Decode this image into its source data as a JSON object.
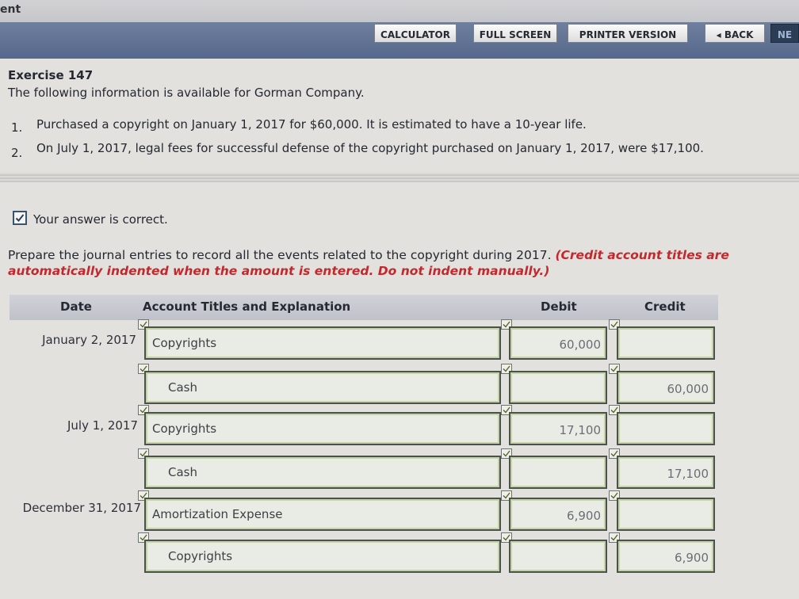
{
  "header": {
    "section_word": "ent"
  },
  "toolbar": {
    "calculator": "CALCULATOR",
    "full_screen": "FULL SCREEN",
    "printer_version": "PRINTER VERSION",
    "back": "◂ BACK",
    "next": "NE"
  },
  "exercise": {
    "title": "Exercise 147",
    "intro": "The following information is available for Gorman Company.",
    "items": [
      {
        "num": "1.",
        "text": "Purchased a copyright on January 1, 2017 for $60,000. It is estimated to have a 10-year life."
      },
      {
        "num": "2.",
        "text": "On July 1, 2017, legal fees for successful defense of the copyright purchased on January 1, 2017, were $17,100."
      }
    ]
  },
  "feedback": {
    "message": "Your answer is correct."
  },
  "instruction": {
    "text": "Prepare the journal entries to record all the events related to the copyright during 2017.",
    "note": "(Credit account titles are automatically indented when the amount is entered. Do not indent manually.)"
  },
  "table": {
    "headers": {
      "date": "Date",
      "account": "Account Titles and Explanation",
      "debit": "Debit",
      "credit": "Credit"
    },
    "rows": [
      {
        "date": "January 2, 2017",
        "account": "Copyrights",
        "debit": "60,000",
        "credit": ""
      },
      {
        "date": "",
        "account": "Cash",
        "debit": "",
        "credit": "60,000"
      },
      {
        "date": "July 1, 2017",
        "account": "Copyrights",
        "debit": "17,100",
        "credit": ""
      },
      {
        "date": "",
        "account": "Cash",
        "debit": "",
        "credit": "17,100"
      },
      {
        "date": "December 31, 2017",
        "account": "Amortization Expense",
        "debit": "6,900",
        "credit": ""
      },
      {
        "date": "",
        "account": "Copyrights",
        "debit": "",
        "credit": "6,900"
      }
    ]
  },
  "colors": {
    "toolbar": "#5f7092",
    "note_red": "#c3282c",
    "field_border": "#4a5250"
  }
}
